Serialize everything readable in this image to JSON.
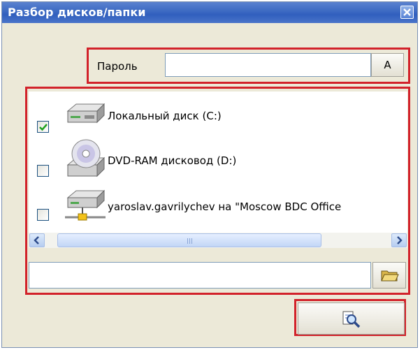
{
  "window": {
    "title": "Разбор дисков/папки"
  },
  "password": {
    "label": "Пароль",
    "value": "",
    "button_label": "A"
  },
  "drives": [
    {
      "label": "Локальный диск (C:)",
      "checked": true,
      "icon": "hard-drive-icon"
    },
    {
      "label": "DVD-RAM дисковод (D:)",
      "checked": false,
      "icon": "dvd-drive-icon"
    },
    {
      "label": "yaroslav.gavrilychev на \"Moscow BDC Office",
      "checked": false,
      "icon": "network-drive-icon"
    }
  ],
  "path": {
    "value": ""
  },
  "colors": {
    "highlight": "#d2222a",
    "titlebar": "#3f6cc4",
    "window_bg": "#ece9d8"
  }
}
